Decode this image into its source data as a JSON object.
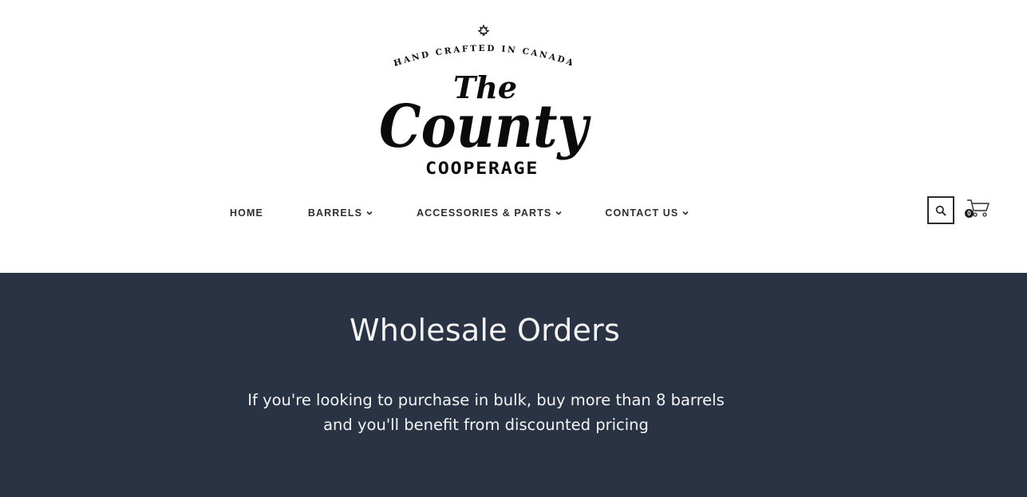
{
  "logo": {
    "tagline": "HAND CRAFTED IN CANADA",
    "script_top": "The",
    "script_main": "County",
    "wordmark": "COOPERAGE",
    "icon": "maple-leaf-icon"
  },
  "nav": {
    "items": [
      {
        "label": "HOME",
        "has_dropdown": false
      },
      {
        "label": "BARRELS",
        "has_dropdown": true
      },
      {
        "label": "ACCESSORIES & PARTS",
        "has_dropdown": true
      },
      {
        "label": "CONTACT US",
        "has_dropdown": true
      }
    ]
  },
  "header_actions": {
    "search_icon": "search-icon",
    "cart_icon": "cart-icon",
    "cart_count": "0"
  },
  "hero": {
    "title": "Wholesale Orders",
    "text": "If you're looking to purchase in bulk, buy more than 8 barrels and you'll benefit from discounted pricing"
  },
  "colors": {
    "hero_background": "#2a3344",
    "hero_text": "#f4f4f4",
    "nav_text": "#2f2f2f"
  }
}
